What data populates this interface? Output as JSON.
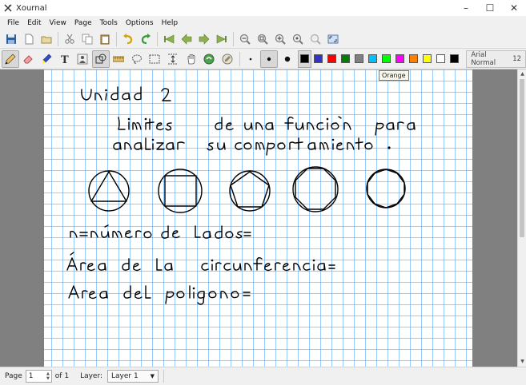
{
  "window": {
    "title": "Xournal",
    "controls": {
      "minimize": "–",
      "maximize": "☐",
      "close": "✕"
    }
  },
  "menu": [
    {
      "label": "File",
      "name": "menu-file"
    },
    {
      "label": "Edit",
      "name": "menu-edit"
    },
    {
      "label": "View",
      "name": "menu-view"
    },
    {
      "label": "Page",
      "name": "menu-page"
    },
    {
      "label": "Tools",
      "name": "menu-tools"
    },
    {
      "label": "Options",
      "name": "menu-options"
    },
    {
      "label": "Help",
      "name": "menu-help"
    }
  ],
  "toolbar_main": [
    "save-icon",
    "new-icon",
    "open-icon",
    "cut-icon",
    "copy-icon",
    "paste-icon",
    "undo-icon",
    "redo-icon",
    "first-page-icon",
    "previous-page-icon",
    "next-page-icon",
    "last-page-icon",
    "zoom-out-icon",
    "zoom-fit-icon",
    "zoom-in-icon",
    "zoom-normal-icon",
    "zoom-set-icon",
    "fullscreen-icon"
  ],
  "toolbar_tools": [
    "pen-icon",
    "eraser-icon",
    "highlighter-icon",
    "text-icon",
    "image-icon",
    "shape-recognizer-icon",
    "ruler-icon",
    "lasso-select-icon",
    "rect-select-icon",
    "vertical-space-icon",
    "hand-icon",
    "default-tool-icon",
    "default-pen-icon",
    "thin-dot-icon",
    "medium-dot-icon",
    "thick-dot-icon"
  ],
  "palette": [
    {
      "name": "black",
      "hex": "#000000"
    },
    {
      "name": "blue",
      "hex": "#3333cc"
    },
    {
      "name": "red",
      "hex": "#ff0000"
    },
    {
      "name": "green",
      "hex": "#008000"
    },
    {
      "name": "gray",
      "hex": "#808080"
    },
    {
      "name": "light-blue",
      "hex": "#00c0ff"
    },
    {
      "name": "light-green",
      "hex": "#00ff00"
    },
    {
      "name": "magenta",
      "hex": "#ff00ff"
    },
    {
      "name": "orange",
      "hex": "#ff8000"
    },
    {
      "name": "yellow",
      "hex": "#ffff00"
    },
    {
      "name": "white",
      "hex": "#ffffff"
    },
    {
      "name": "black-2",
      "hex": "#000000"
    }
  ],
  "selected_color": "black",
  "font": {
    "name": "Arial Normal",
    "size": "12"
  },
  "tooltip": "Orange",
  "page_colors": {
    "grid": "#40a0ff",
    "background": "#808080",
    "ink": "#000000"
  },
  "status": {
    "page_label": "Page",
    "page_value": "1",
    "of_label": "of 1",
    "layer_label": "Layer:",
    "layer_value": "Layer 1"
  }
}
